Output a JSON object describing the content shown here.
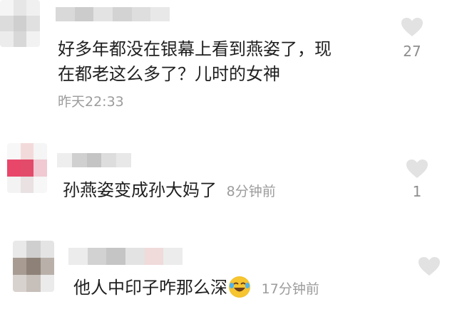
{
  "comments": [
    {
      "line1": "好多年都没在银幕上看到燕姿了，现",
      "line2": "在都老这么多了？儿时的女神",
      "time": "昨天22:33",
      "likes": "27"
    },
    {
      "text": "孙燕姿变成孙大妈了",
      "time": "8分钟前",
      "likes": "1"
    },
    {
      "text": "他人中印子咋那么深",
      "time": "17分钟前",
      "emoji": "laughing-crying-emoji"
    }
  ],
  "icons": {
    "like": "heart-icon"
  },
  "colors": {
    "text": "#1f1f1f",
    "meta": "#9c9c9c",
    "heart": "#e2e2e2"
  }
}
